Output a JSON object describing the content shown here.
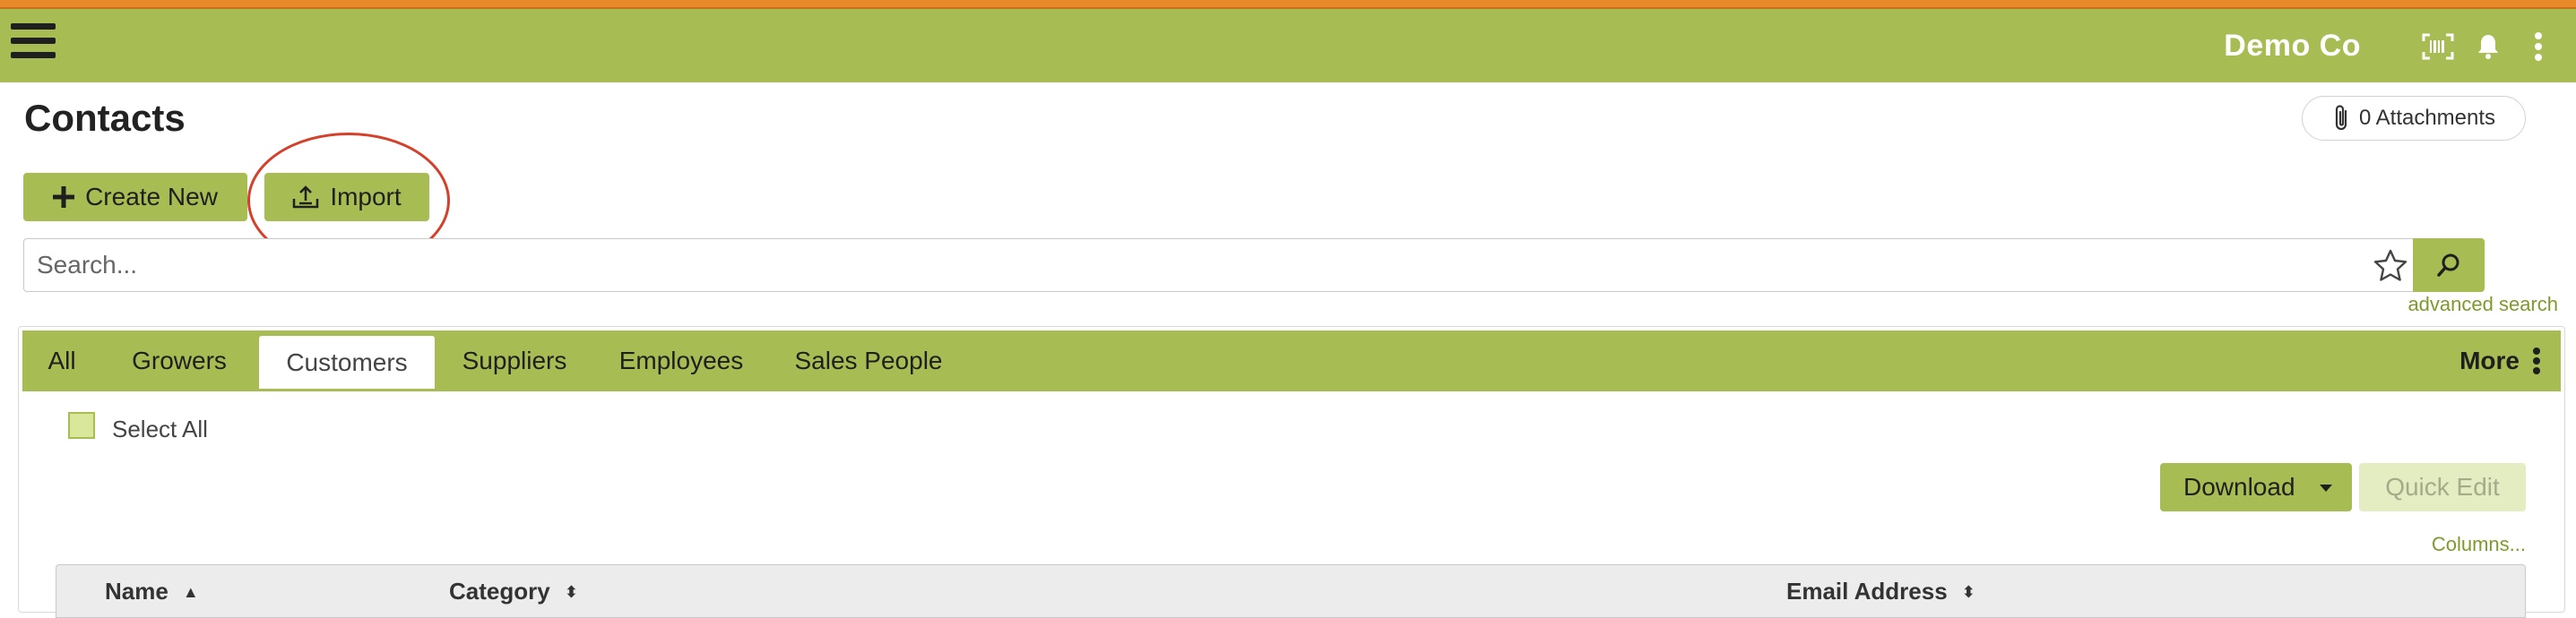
{
  "header": {
    "company": "Demo Co",
    "icons": [
      "menu-icon",
      "barcode-scan-icon",
      "bell-icon",
      "more-vertical-icon"
    ]
  },
  "page": {
    "title": "Contacts",
    "attachments_label": "0 Attachments"
  },
  "actions": {
    "create_label": "Create New",
    "import_label": "Import"
  },
  "search": {
    "placeholder": "Search...",
    "value": "",
    "advanced_label": "advanced search"
  },
  "tabs": {
    "items": [
      "All",
      "Growers",
      "Customers",
      "Suppliers",
      "Employees",
      "Sales People"
    ],
    "active": "Customers",
    "more_label": "More"
  },
  "list": {
    "select_all_label": "Select All",
    "download_label": "Download",
    "quick_edit_label": "Quick Edit",
    "columns_label": "Columns...",
    "headers": [
      "Name",
      "Category",
      "Email Address"
    ]
  },
  "colors": {
    "brand": "#a7bd53",
    "top_stripe": "#e98a2a",
    "annotation": "#d5402b",
    "link": "#7f9a2c"
  }
}
